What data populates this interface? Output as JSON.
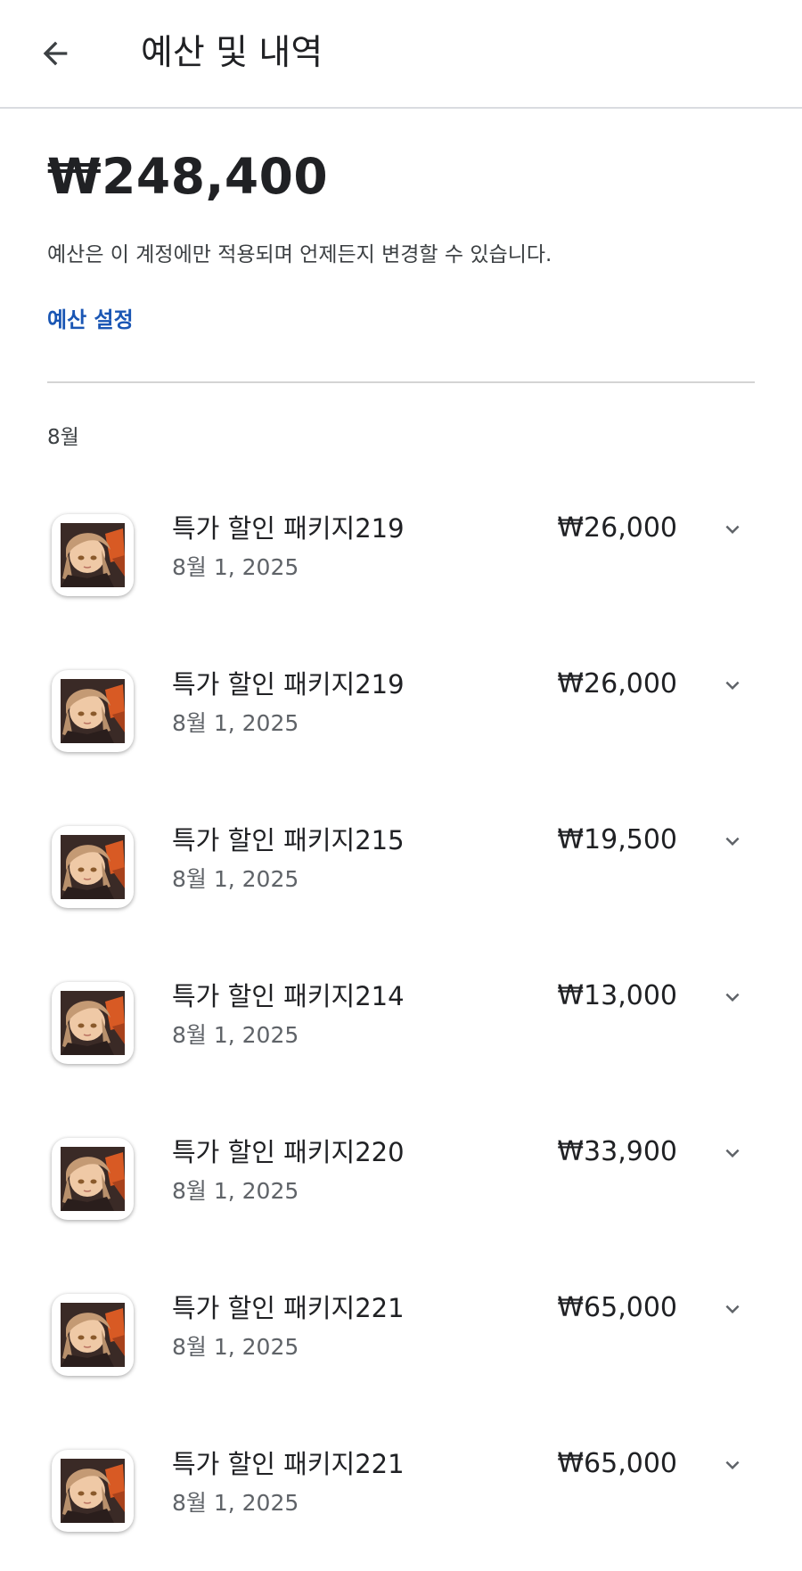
{
  "header": {
    "title": "예산 및 내역",
    "back_icon": "arrow-back-icon"
  },
  "summary": {
    "total": "₩248,400",
    "description": "예산은 이 계정에만 적용되며 언제든지 변경할 수 있습니다.",
    "budget_link": "예산 설정"
  },
  "colors": {
    "link": "#1a56b4",
    "divider": "#d4d4d4",
    "secondary_text": "#5f6368"
  },
  "history": {
    "month_label": "8월",
    "items": [
      {
        "title": "특가 할인 패키지219",
        "date": "8월 1, 2025",
        "price": "₩26,000",
        "icon": "app-icon",
        "expand_icon": "chevron-down-icon"
      },
      {
        "title": "특가 할인 패키지219",
        "date": "8월 1, 2025",
        "price": "₩26,000",
        "icon": "app-icon",
        "expand_icon": "chevron-down-icon"
      },
      {
        "title": "특가 할인 패키지215",
        "date": "8월 1, 2025",
        "price": "₩19,500",
        "icon": "app-icon",
        "expand_icon": "chevron-down-icon"
      },
      {
        "title": "특가 할인 패키지214",
        "date": "8월 1, 2025",
        "price": "₩13,000",
        "icon": "app-icon",
        "expand_icon": "chevron-down-icon"
      },
      {
        "title": "특가 할인 패키지220",
        "date": "8월 1, 2025",
        "price": "₩33,900",
        "icon": "app-icon",
        "expand_icon": "chevron-down-icon"
      },
      {
        "title": "특가 할인 패키지221",
        "date": "8월 1, 2025",
        "price": "₩65,000",
        "icon": "app-icon",
        "expand_icon": "chevron-down-icon"
      },
      {
        "title": "특가 할인 패키지221",
        "date": "8월 1, 2025",
        "price": "₩65,000",
        "icon": "app-icon",
        "expand_icon": "chevron-down-icon"
      }
    ]
  }
}
